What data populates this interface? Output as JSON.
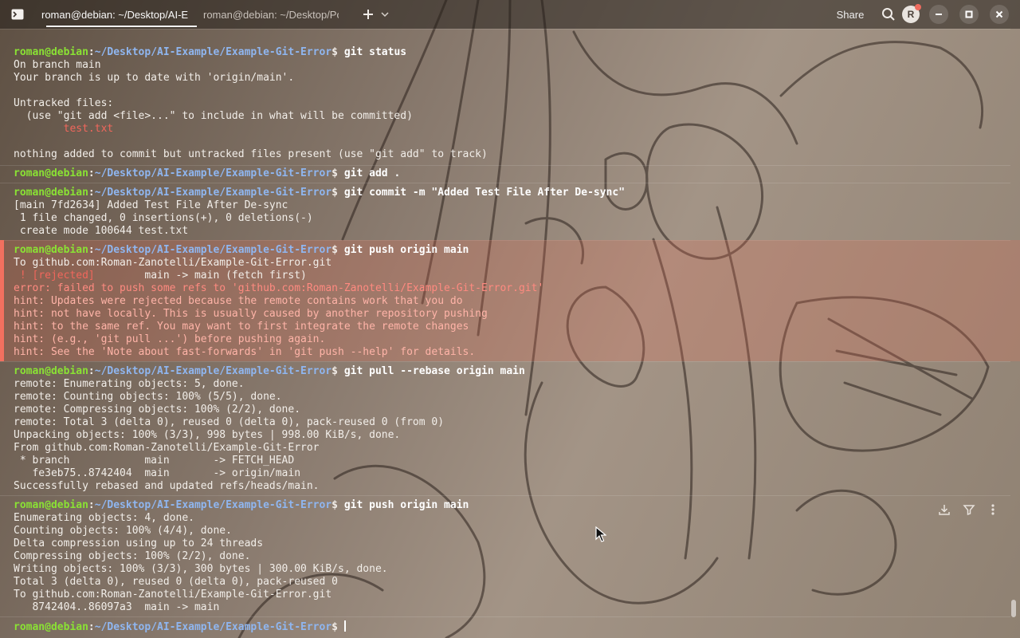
{
  "titlebar": {
    "tabs": [
      {
        "label": "roman@debian: ~/Desktop/AI-E",
        "active": true
      },
      {
        "label": "roman@debian: ~/Desktop/Por",
        "active": false
      }
    ],
    "share_label": "Share",
    "avatar_initial": "R",
    "icons": [
      "terminal-app-icon",
      "plus-icon",
      "chevron-down-icon",
      "search-icon",
      "minimize-icon",
      "maximize-icon",
      "close-icon"
    ]
  },
  "prompt": {
    "user": "roman@debian",
    "colon": ":",
    "path": "~/Desktop/AI-Example/Example-Git-Error",
    "dollar": "$"
  },
  "blocks": {
    "status": {
      "command": "git status",
      "lines": [
        "On branch main",
        "Your branch is up to date with 'origin/main'.",
        "",
        "Untracked files:",
        "  (use \"git add <file>...\" to include in what will be committed)",
        "        test.txt",
        "",
        "nothing added to commit but untracked files present (use \"git add\" to track)"
      ]
    },
    "add": {
      "command": "git add ."
    },
    "commit": {
      "command": "git commit -m \"Added Test File After De-sync\"",
      "lines": [
        "[main 7fd2634] Added Test File After De-sync",
        " 1 file changed, 0 insertions(+), 0 deletions(-)",
        " create mode 100644 test.txt"
      ]
    },
    "push_fail": {
      "command": "git push origin main",
      "to_line": "To github.com:Roman-Zanotelli/Example-Git-Error.git",
      "rejected_tag": " ! [rejected]",
      "rejected_rest": "        main -> main (fetch first)",
      "error_line": "error: failed to push some refs to 'github.com:Roman-Zanotelli/Example-Git-Error.git'",
      "hints": [
        "hint: Updates were rejected because the remote contains work that you do",
        "hint: not have locally. This is usually caused by another repository pushing",
        "hint: to the same ref. You may want to first integrate the remote changes",
        "hint: (e.g., 'git pull ...') before pushing again.",
        "hint: See the 'Note about fast-forwards' in 'git push --help' for details."
      ]
    },
    "pull": {
      "command": "git pull --rebase origin main",
      "lines": [
        "remote: Enumerating objects: 5, done.",
        "remote: Counting objects: 100% (5/5), done.",
        "remote: Compressing objects: 100% (2/2), done.",
        "remote: Total 3 (delta 0), reused 0 (delta 0), pack-reused 0 (from 0)",
        "Unpacking objects: 100% (3/3), 998 bytes | 998.00 KiB/s, done.",
        "From github.com:Roman-Zanotelli/Example-Git-Error",
        " * branch            main       -> FETCH_HEAD",
        "   fe3eb75..8742404  main       -> origin/main",
        "Successfully rebased and updated refs/heads/main."
      ]
    },
    "push_ok": {
      "command": "git push origin main",
      "lines": [
        "Enumerating objects: 4, done.",
        "Counting objects: 100% (4/4), done.",
        "Delta compression using up to 24 threads",
        "Compressing objects: 100% (2/2), done.",
        "Writing objects: 100% (3/3), 300 bytes | 300.00 KiB/s, done.",
        "Total 3 (delta 0), reused 0 (delta 0), pack-reused 0",
        "To github.com:Roman-Zanotelli/Example-Git-Error.git",
        "   8742404..86097a3  main -> main"
      ]
    }
  },
  "colors": {
    "prompt_user": "#8ae234",
    "prompt_path": "#8fb6f0",
    "error": "#f1675c",
    "error_bar": "#f2705f"
  }
}
